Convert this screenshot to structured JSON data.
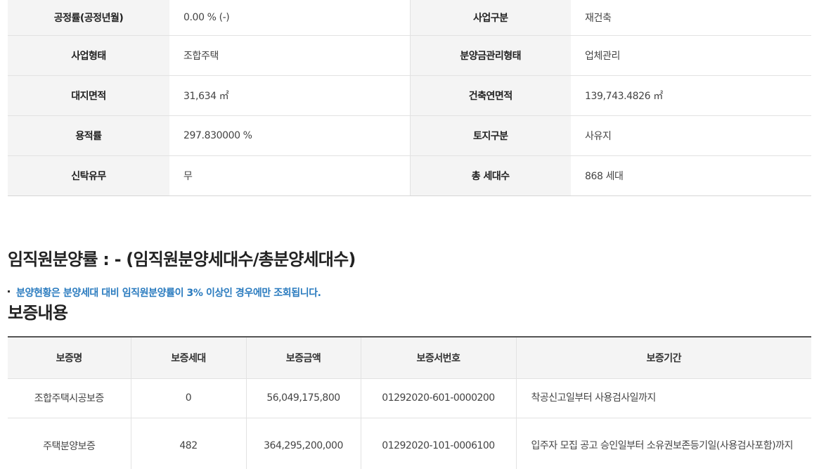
{
  "info": [
    {
      "l1": "공정률(공정년월)",
      "v1": "0.00 % (-)",
      "l2": "사업구분",
      "v2": "재건축"
    },
    {
      "l1": "사업형태",
      "v1": "조합주택",
      "l2": "분양금관리형태",
      "v2": "업체관리"
    },
    {
      "l1": "대지면적",
      "v1": "31,634 ㎡",
      "l2": "건축연면적",
      "v2": "139,743.4826 ㎡"
    },
    {
      "l1": "용적률",
      "v1": "297.830000 %",
      "l2": "토지구분",
      "v2": "사유지"
    },
    {
      "l1": "신탁유무",
      "v1": "무",
      "l2": "총 세대수",
      "v2": "868 세대"
    }
  ],
  "sale_rate_title": "임직원분양률 : - (임직원분양세대수/총분양세대수)",
  "notice": "분양현황은 분양세대 대비 임직원분양률이 3% 이상인 경우에만 조회됩니다.",
  "guarantee_title": "보증내용",
  "guarantee": {
    "headers": [
      "보증명",
      "보증세대",
      "보증금액",
      "보증서번호",
      "보증기간"
    ],
    "rows": [
      [
        "조합주택시공보증",
        "0",
        "56,049,175,800",
        "01292020-601-0000200",
        "착공신고일부터 사용검사일까지"
      ],
      [
        "주택분양보증",
        "482",
        "364,295,200,000",
        "01292020-101-0006100",
        "입주자 모집 공고 승인일부터 소유권보존등기일(사용검사포함)까지"
      ]
    ]
  }
}
